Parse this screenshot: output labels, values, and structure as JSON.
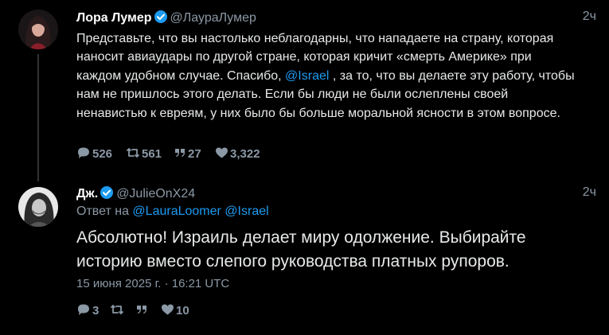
{
  "tweet1": {
    "author_name": "Лора Лумер",
    "handle": "@ЛаураЛумер",
    "time": "2ч",
    "text_before": "Представьте, что вы настолько неблагодарны, что нападаете на страну, которая наносит авиаудары по другой стране, которая кричит «смерть Америке» при каждом удобном случае. Спасибо, ",
    "mention": "@Israel",
    "text_after": " , за то, что вы делаете эту работу, чтобы нам не пришлось этого делать. Если бы люди не были ослеплены своей ненавистью к евреям, у них было бы больше моральной ясности в этом вопросе.",
    "replies": "526",
    "retweets": "561",
    "quotes": "27",
    "likes": "3,322"
  },
  "tweet2": {
    "author_name": "Дж.",
    "handle": "@JulieOnX24",
    "time": "2ч",
    "reply_prefix": "Ответ на",
    "reply_mention_1": "@LauraLoomer",
    "reply_mention_2": "@Israel",
    "text": "Абсолютно! Израиль делает миру одолжение. Выбирайте историю вместо слепого руководства платных рупоров.",
    "date": "15 июня 2025 г. · 16:21 UTC",
    "replies": "3",
    "likes": "10"
  },
  "colors": {
    "background": "#000000",
    "accent": "#1d9bf0",
    "muted": "#8b98a5",
    "text": "#e7e9ea"
  },
  "icons": [
    "verified-icon",
    "reply-icon",
    "retweet-icon",
    "quote-icon",
    "like-icon"
  ]
}
